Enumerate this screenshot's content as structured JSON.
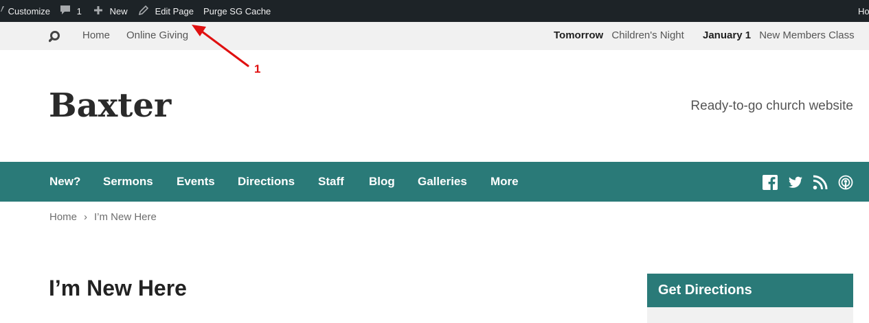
{
  "admin_bar": {
    "customize": "Customize",
    "comments_count": "1",
    "new_label": "New",
    "edit_page": "Edit Page",
    "purge_cache": "Purge SG Cache",
    "howdy_partial": "Ho"
  },
  "top_bar": {
    "links": [
      "Home",
      "Online Giving"
    ],
    "events": [
      {
        "when": "Tomorrow",
        "title": "Children's Night"
      },
      {
        "when": "January 1",
        "title": "New Members Class"
      }
    ]
  },
  "header": {
    "site_title": "Baxter",
    "tagline": "Ready-to-go church website"
  },
  "main_nav": {
    "items": [
      "New?",
      "Sermons",
      "Events",
      "Directions",
      "Staff",
      "Blog",
      "Galleries",
      "More"
    ],
    "social_icons": [
      "facebook-icon",
      "twitter-icon",
      "rss-icon",
      "podcast-icon"
    ]
  },
  "breadcrumb": {
    "home": "Home",
    "separator": "›",
    "current": "I’m New Here"
  },
  "page": {
    "title": "I’m New Here"
  },
  "sidebar": {
    "widget_title": "Get Directions"
  },
  "annotation": {
    "number": "1",
    "color": "#e01010"
  },
  "colors": {
    "admin_bar": "#1d2327",
    "top_bar": "#f1f1f1",
    "accent": "#2a7a78"
  }
}
